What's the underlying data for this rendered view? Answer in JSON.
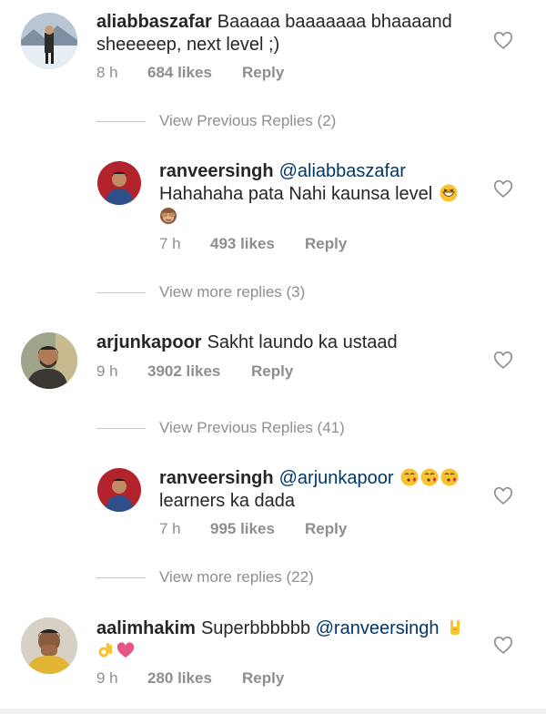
{
  "comments": [
    {
      "user": "aliabbaszafar",
      "text_line1": "Baaaaa baaaaaaa bhaaaand",
      "text_line2": "sheeeeep, next level ;)",
      "time": "8 h",
      "likes": "684 likes",
      "reply": "Reply",
      "avatar": "man-in-snow-avatar",
      "liked": false
    },
    {
      "user": "ranveersingh",
      "mention": "@aliabbaszafar",
      "text_line2": "Hahahaha pata Nahi kaunsa level",
      "emojis": [
        "grinning-squinting-face",
        "see-no-evil-monkey"
      ],
      "time": "7 h",
      "likes": "493 likes",
      "reply": "Reply",
      "avatar": "man-in-blue-shirt-avatar",
      "liked": false
    },
    {
      "user": "arjunkapoor",
      "text": "Sakht laundo ka ustaad",
      "time": "9 h",
      "likes": "3902 likes",
      "reply": "Reply",
      "avatar": "bearded-man-avatar",
      "liked": false
    },
    {
      "user": "ranveersingh",
      "mention": "@arjunkapoor",
      "emojis": [
        "kissing-heart-face",
        "kissing-heart-face",
        "kissing-heart-face"
      ],
      "text_line2": "learners ka dada",
      "time": "7 h",
      "likes": "995 likes",
      "reply": "Reply",
      "avatar": "man-in-blue-shirt-avatar",
      "liked": false
    },
    {
      "user": "aalimhakim",
      "text": "Superbbbbbb",
      "mention": "@ranveersingh",
      "emojis": [
        "sign-of-horns-hand",
        "ok-hand",
        "pink-heart"
      ],
      "time": "9 h",
      "likes": "280 likes",
      "reply": "Reply",
      "avatar": "man-with-hand-on-face-avatar",
      "liked": false
    }
  ],
  "view_rows": [
    {
      "text": "View Previous Replies (2)"
    },
    {
      "text": "View more replies (3)"
    },
    {
      "text": "View Previous Replies (41)"
    },
    {
      "text": "View more replies (22)"
    }
  ],
  "colors": {
    "username": "#262626",
    "mention": "#00376b",
    "meta": "#8e8e8e",
    "heart_outline": "#8e8e8e"
  }
}
